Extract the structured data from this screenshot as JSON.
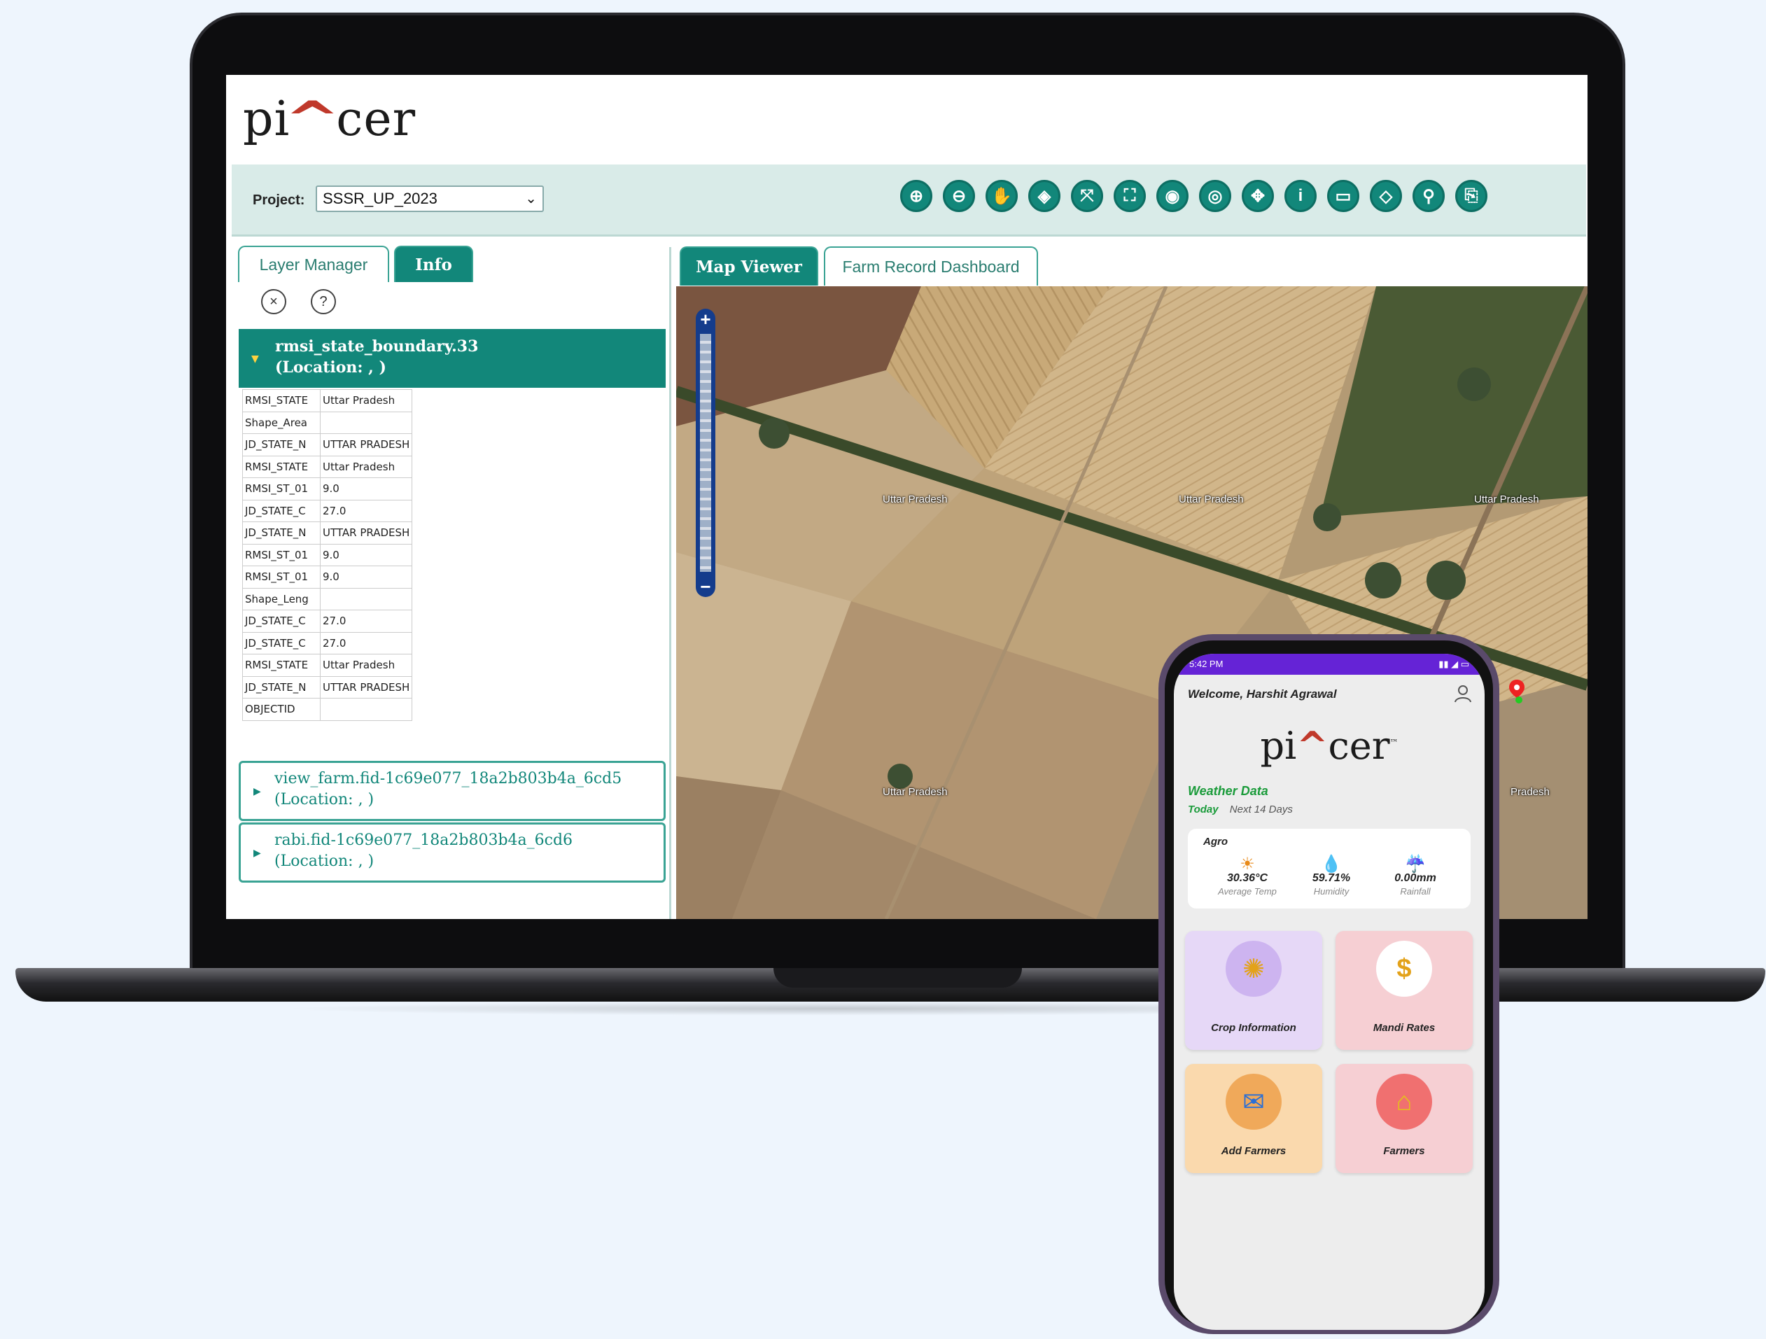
{
  "app": {
    "logo_pre": "pi",
    "logo_hat": "^",
    "logo_post": "cer"
  },
  "toolbar": {
    "project_label": "Project:",
    "project_value": "SSSR_UP_2023",
    "tools": [
      {
        "name": "zoom-in-icon",
        "glyph": "⊕"
      },
      {
        "name": "zoom-out-icon",
        "glyph": "⊖"
      },
      {
        "name": "pan-hand-icon",
        "glyph": "✋"
      },
      {
        "name": "layers-icon",
        "glyph": "◈"
      },
      {
        "name": "zoom-to-extent-icon",
        "glyph": "⤧"
      },
      {
        "name": "full-extent-icon",
        "glyph": "⛶"
      },
      {
        "name": "zoom-previous-icon",
        "glyph": "◉"
      },
      {
        "name": "zoom-next-icon",
        "glyph": "◎"
      },
      {
        "name": "fit-view-icon",
        "glyph": "✥"
      },
      {
        "name": "info-icon",
        "glyph": "i"
      },
      {
        "name": "measure-icon",
        "glyph": "▭"
      },
      {
        "name": "eraser-icon",
        "glyph": "◇"
      },
      {
        "name": "search-icon",
        "glyph": "⚲"
      },
      {
        "name": "export-icon",
        "glyph": "⎘"
      }
    ]
  },
  "left_panel": {
    "tabs": {
      "layer_manager": "Layer Manager",
      "info": "Info"
    },
    "controls": {
      "close": "×",
      "help": "?"
    },
    "selected_feature": {
      "title": "rmsi_state_boundary.33",
      "location": "(Location: , )"
    },
    "attributes": [
      [
        "RMSI_STATE",
        "Uttar Pradesh"
      ],
      [
        "Shape_Area",
        ""
      ],
      [
        "JD_STATE_N",
        "UTTAR PRADESH"
      ],
      [
        "RMSI_STATE",
        "Uttar Pradesh"
      ],
      [
        "RMSI_ST_01",
        "9.0"
      ],
      [
        "JD_STATE_C",
        "27.0"
      ],
      [
        "JD_STATE_N",
        "UTTAR PRADESH"
      ],
      [
        "RMSI_ST_01",
        "9.0"
      ],
      [
        "RMSI_ST_01",
        "9.0"
      ],
      [
        "Shape_Leng",
        ""
      ],
      [
        "JD_STATE_C",
        "27.0"
      ],
      [
        "JD_STATE_C",
        "27.0"
      ],
      [
        "RMSI_STATE",
        "Uttar Pradesh"
      ],
      [
        "JD_STATE_N",
        "UTTAR PRADESH"
      ],
      [
        "OBJECTID",
        ""
      ]
    ],
    "other_features": [
      {
        "title": "view_farm.fid-1c69e077_18a2b803b4a_6cd5",
        "location": "(Location: , )"
      },
      {
        "title": "rabi.fid-1c69e077_18a2b803b4a_6cd6",
        "location": "(Location: , )"
      }
    ]
  },
  "map_tabs": {
    "map_viewer": "Map Viewer",
    "farm_record": "Farm Record Dashboard"
  },
  "map": {
    "zoom_in": "+",
    "zoom_out": "−",
    "labels": [
      "Uttar Pradesh",
      "Uttar Pradesh",
      "Uttar Pradesh",
      "Uttar Pradesh",
      "Pradesh"
    ]
  },
  "phone": {
    "status_time": "5:42 PM",
    "status_right": "▮▮ ◢ ▭",
    "welcome": "Welcome, Harshit Agrawal",
    "logo_pre": "pi",
    "logo_hat": "^",
    "logo_post": "cer",
    "logo_tm": "™",
    "weather_title": "Weather Data",
    "weather_today": "Today",
    "weather_next": "Next 14 Days",
    "agro_title": "Agro",
    "stats": [
      {
        "icon": "☀",
        "value": "30.36°C",
        "label": "Average Temp"
      },
      {
        "icon": "💧",
        "value": "59.71%",
        "label": "Humidity"
      },
      {
        "icon": "☔",
        "value": "0.00mm",
        "label": "Rainfall"
      }
    ],
    "tiles": [
      {
        "label": "Crop Information",
        "icon": "✺"
      },
      {
        "label": "Mandi Rates",
        "icon": "$"
      },
      {
        "label": "Add Farmers",
        "icon": "✉"
      },
      {
        "label": "Farmers",
        "icon": "⌂"
      }
    ],
    "colors": {
      "status_bar": "#6523d6",
      "green": "#1a9b3a",
      "crop_tile": "#e6d8f7",
      "mandi_tile": "#f6cfd3",
      "add_tile": "#fad9ad",
      "farmers_tile": "#f6cfd3"
    }
  },
  "colors": {
    "accent": "#12877a",
    "toolbar_bg": "#d9ebe8",
    "background": "#eef5fd"
  }
}
